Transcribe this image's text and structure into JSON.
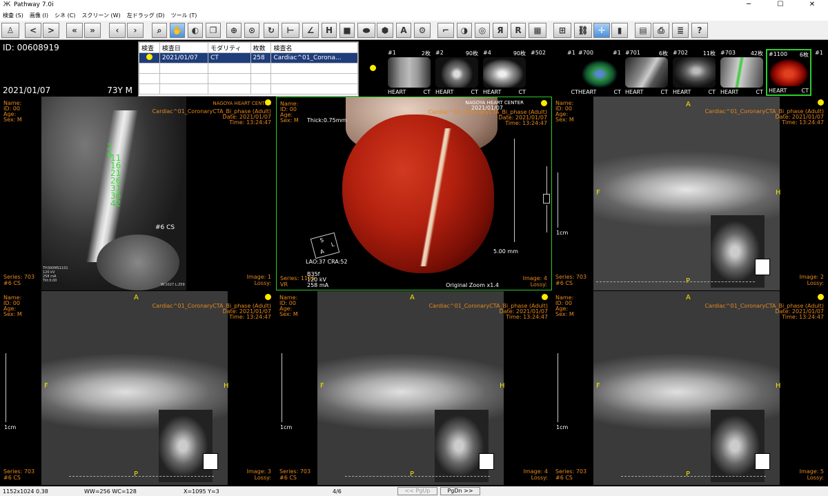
{
  "window": {
    "title": "Pathway 7.0i",
    "minimize": "─",
    "maximize": "☐",
    "close": "✕"
  },
  "menu": [
    "検査 (S)",
    "画像 (I)",
    "シネ (C)",
    "スクリーン (W)",
    "左ドラッグ (D)",
    "ツール (T)"
  ],
  "patient": {
    "id": "ID: 00608919",
    "date": "2021/01/07",
    "age_sex": "73Y M"
  },
  "study_table": {
    "headers": [
      "検査",
      "検査日",
      "モダリティ",
      "枚数",
      "検査名"
    ],
    "rows": [
      {
        "date": "2021/01/07",
        "modality": "CT",
        "count": "258",
        "name": "Cardiac^01_Corona..."
      }
    ]
  },
  "thumbnails": [
    {
      "num": "#1",
      "count": "2枚",
      "left": "HEART",
      "right": "CT"
    },
    {
      "num": "#2",
      "count": "90枚",
      "left": "HEART",
      "right": "CT"
    },
    {
      "num": "#4",
      "count": "90枚",
      "left": "HEART",
      "right": "CT"
    },
    {
      "num": "#502",
      "count": "",
      "left": "",
      "right": ""
    },
    {
      "num": "#1",
      "count": "",
      "left": "",
      "right": "CT"
    },
    {
      "num": "#700",
      "count": "",
      "left": "HEART",
      "right": "CT"
    },
    {
      "num": "#1",
      "count": "",
      "left": "",
      "right": ""
    },
    {
      "num": "#701",
      "count": "6枚",
      "left": "HEART",
      "right": "CT"
    },
    {
      "num": "#702",
      "count": "11枚",
      "left": "HEART",
      "right": "CT"
    },
    {
      "num": "#703",
      "count": "42枚",
      "left": "HEART",
      "right": "CT"
    },
    {
      "num": "#1100",
      "count": "6枚",
      "left": "HEART",
      "right": "CT"
    },
    {
      "num": "#1",
      "count": "",
      "left": "",
      "right": ""
    }
  ],
  "viewports": {
    "common": {
      "name": "Name:",
      "id": "ID: 00",
      "age": "Age:",
      "sex": "Sex: M",
      "institution": "NAGOYA HEART CENTER",
      "study": "Cardiac^01_CoronaryCTA_Bi_phase (Adult)",
      "date": "Date: 2021/01/07",
      "time": "Time: 13:24:47",
      "lossy": "Lossy:",
      "series_703": "Series: 703",
      "cs": "#6 CS",
      "orient_a": "A",
      "orient_f": "F",
      "orient_h": "H",
      "orient_p": "P",
      "scale": "1cm"
    },
    "vp1": {
      "image": "Image: 1",
      "cs_label": "#6 CS",
      "wl": "W:1027 L:259",
      "params": "TH300MS1101\n120 kV\n258 mA\nTilt:0.00",
      "numbers": [
        "2",
        "6",
        "11",
        "16",
        "21",
        "26",
        "31",
        "36",
        "42"
      ]
    },
    "vp2": {
      "date": "2021/01/07",
      "thick": "Thick:0.75mm",
      "angle": "LAO:37 CRA:52",
      "params": "B35f\n120 kV\n258 mA",
      "series": "Series: 1100",
      "vr": "VR",
      "image": "Image: 4",
      "zoom": "Original Zoom x1.4",
      "mm": "5.00 mm",
      "cube_s": "S",
      "cube_a": "A",
      "cube_l": "L"
    },
    "vp3": {
      "image": "Image: 2"
    },
    "vp4": {
      "image": "Image: 3"
    },
    "vp5": {
      "image": "Image: 4"
    },
    "vp6": {
      "image": "Image: 5"
    }
  },
  "status": {
    "size": "1152x1024 0.38",
    "wwwc": "WW=256 WC=128",
    "coord": "X=1095 Y=3",
    "page": "4/6",
    "pgup": "<< PgUp",
    "pgdn": "PgDn >>"
  }
}
